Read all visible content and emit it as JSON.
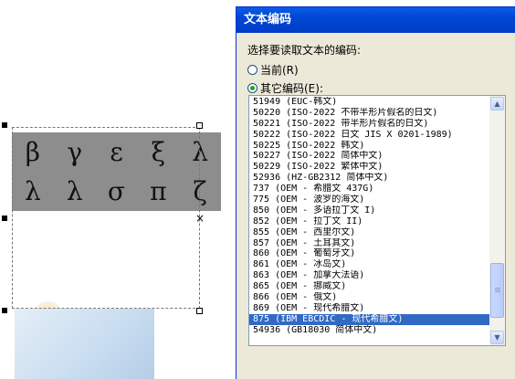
{
  "document": {
    "greek_rows": [
      [
        "β",
        "γ",
        "ε",
        "ξ",
        "λ"
      ],
      [
        "λ",
        "λ",
        "σ",
        "π",
        "ζ"
      ]
    ],
    "close_symbol": "×"
  },
  "dialog": {
    "title": "文本编码",
    "prompt": "选择要读取文本的编码:",
    "option_current": "当前(R)",
    "option_other": "其它编码(E):",
    "selected_option": "other",
    "encodings": [
      "51949 (EUC-韩文)",
      "50220 (ISO-2022 不带半形片假名的日文)",
      "50221 (ISO-2022 带半形片假名的日文)",
      "50222 (ISO-2022 日文 JIS X 0201-1989)",
      "50225 (ISO-2022 韩文)",
      "50227 (ISO-2022 简体中文)",
      "50229 (ISO-2022 繁体中文)",
      "52936 (HZ-GB2312 简体中文)",
      "737   (OEM - 希腊文 437G)",
      "775   (OEM - 波罗的海文)",
      "850   (OEM - 多语拉丁文 I)",
      "852   (OEM - 拉丁文 II)",
      "855   (OEM - 西里尔文)",
      "857   (OEM - 土耳其文)",
      "860   (OEM - 葡萄牙文)",
      "861   (OEM - 冰岛文)",
      "863   (OEM - 加拿大法语)",
      "865   (OEM - 挪威文)",
      "866   (OEM - 俄文)",
      "869   (OEM - 现代希腊文)",
      "875   (IBM EBCDIC - 现代希腊文)",
      "54936 (GB18030 简体中文)"
    ],
    "selected_encoding_index": 20
  },
  "colors": {
    "title_bar": "#0047d4",
    "selection": "#316ac5",
    "greek_background": "#8d8d8d"
  }
}
